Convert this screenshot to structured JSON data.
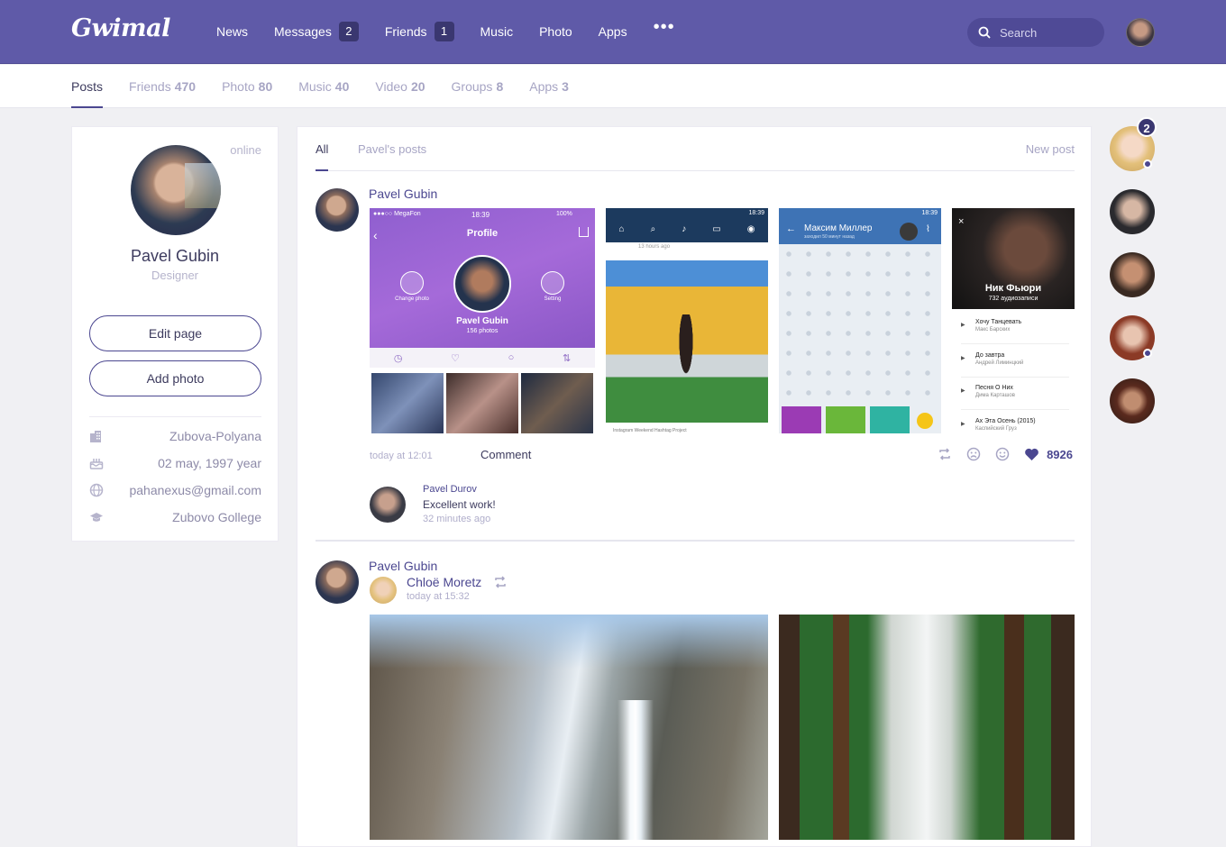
{
  "app": {
    "logo": "Gwimal"
  },
  "header": {
    "nav": [
      {
        "label": "News"
      },
      {
        "label": "Messages",
        "badge": "2"
      },
      {
        "label": "Friends",
        "badge": "1"
      },
      {
        "label": "Music"
      },
      {
        "label": "Photo"
      },
      {
        "label": "Apps"
      }
    ],
    "more": "•••",
    "search_placeholder": "Search"
  },
  "subnav": {
    "tabs": [
      {
        "label": "Posts",
        "count": ""
      },
      {
        "label": "Friends",
        "count": "470"
      },
      {
        "label": "Photo",
        "count": "80"
      },
      {
        "label": "Music",
        "count": "40"
      },
      {
        "label": "Video",
        "count": "20"
      },
      {
        "label": "Groups",
        "count": "8"
      },
      {
        "label": "Apps",
        "count": "3"
      }
    ]
  },
  "profile": {
    "status": "online",
    "name": "Pavel Gubin",
    "role": "Designer",
    "edit_label": "Edit page",
    "add_photo_label": "Add photo",
    "info": [
      {
        "icon": "building-icon",
        "value": "Zubova-Polyana"
      },
      {
        "icon": "cake-icon",
        "value": "02 may, 1997 year"
      },
      {
        "icon": "globe-icon",
        "value": "pahanexus@gmail.com"
      },
      {
        "icon": "graduation-cap-icon",
        "value": "Zubovo Gollege"
      }
    ]
  },
  "feed": {
    "tabs": [
      "All",
      "Pavel's posts"
    ],
    "new_post": "New post",
    "post1": {
      "author": "Pavel Gubin",
      "time": "today at 12:01",
      "comment_label": "Comment",
      "likes": "8926",
      "tiles": {
        "t1": {
          "carrier": "●●●○○ MegaFon",
          "clock": "18:39",
          "battery": "100%",
          "title": "Profile",
          "change_photo": "Change photo",
          "setting": "Setting",
          "name": "Pavel Gubin",
          "photos": "156 photos"
        },
        "t2": {
          "clock": "18:39",
          "ago": "13 hours ago",
          "caption": "Instagram Weekend Hashtag Project"
        },
        "t3": {
          "clock": "18:39",
          "name": "Максим Миллер",
          "status": "заходил 50 минут назад"
        },
        "t4": {
          "artist": "Ник Фьюри",
          "count": "732 аудиозаписи",
          "tracks": [
            {
              "title": "Хочу Танцевать",
              "artist": "Макс Барских"
            },
            {
              "title": "До завтра",
              "artist": "Андрей Лиминцкий"
            },
            {
              "title": "Песня О Них",
              "artist": "Дима Карташов"
            },
            {
              "title": "Ах Эта Осень (2015)",
              "artist": "Каспийский Груз"
            }
          ]
        }
      },
      "comment": {
        "author": "Pavel Durov",
        "text": "Excellent work!",
        "time": "32 minutes ago"
      }
    },
    "post2": {
      "author": "Pavel Gubin",
      "shared_from": "Chloë  Moretz",
      "time": "today at 15:32"
    }
  },
  "rail": {
    "badge": "2"
  },
  "colors": {
    "brand": "#5f5aa8",
    "accent": "#4b4790",
    "dark_badge": "#3a3770"
  }
}
